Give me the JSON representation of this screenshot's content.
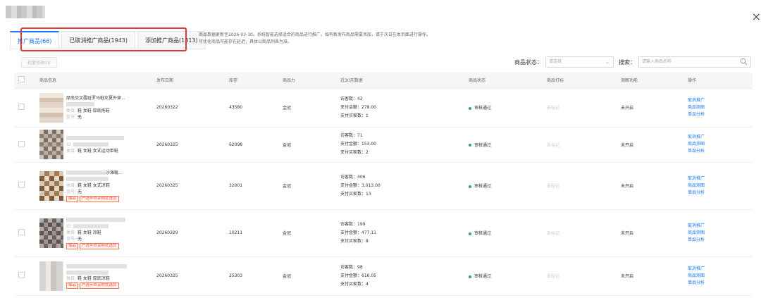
{
  "tabs": [
    {
      "label": "推广商品(66)",
      "active": true
    },
    {
      "label": "已取消推广商品(1943)",
      "active": false
    },
    {
      "label": "添加推广商品(1813)",
      "active": false
    }
  ],
  "close_icon": "×",
  "notice": "商品数据更新至2026-03-30。系统智能选择适合的商品进行推广。如有新发布商品需要添加，请于次日在本页面进行操作。可优化商品可能存在延迟，具体以商品列表为准。",
  "toolbar": {
    "batch_button": "批量修改(0)",
    "status_label": "商品状态：",
    "status_placeholder": "请选择",
    "search_label": "搜索：",
    "search_placeholder": "请输入商品名称"
  },
  "table": {
    "headers": [
      "商品信息",
      "发布日期",
      "库存",
      "商品力",
      "近30天数据",
      "商品状态",
      "商品打标",
      "测图功能",
      "操作"
    ],
    "rows": [
      {
        "title": "厚底交叉露趾罗马鞋女夏外穿...",
        "category": "鞋 女鞋 厚底拖鞋",
        "sku": "无",
        "date": "20260322",
        "stock": "43580",
        "power": "金冠",
        "visitors": "访客数：42",
        "amount": "支付金额：278.00",
        "buyers": "支付买家数：1",
        "status": "审核通过",
        "mark": "去标记",
        "test": "未开启",
        "ops": [
          "取消推广",
          "商品测图",
          "单品分析"
        ]
      },
      {
        "title": "",
        "category": "鞋 女鞋 女式运动单鞋",
        "sku": "",
        "date": "20260325",
        "stock": "62098",
        "power": "金冠",
        "visitors": "访客数：71",
        "amount": "支付金额：153.00",
        "buyers": "支付买家数：2",
        "status": "审核通过",
        "mark": "去标记",
        "test": "未开启",
        "ops": [
          "取消推广",
          "商品测图",
          "单品分析"
        ]
      },
      {
        "title": "沙滩靴...",
        "category": "鞋 女鞋 女式凉鞋",
        "sku": "无",
        "tags": [
          "爆品",
          "严选年终采购优选货"
        ],
        "date": "20260325",
        "stock": "32001",
        "power": "金冠",
        "visitors": "访客数：306",
        "amount": "支付金额：3,013.00",
        "buyers": "支付买家数：13",
        "status": "审核通过",
        "mark": "去标记",
        "test": "未开启",
        "ops": [
          "取消推广",
          "商品测图",
          "单品分析"
        ]
      },
      {
        "title": "",
        "category": "鞋 女鞋 凉鞋",
        "sku": "无",
        "tags": [
          "爆品",
          "严选年终采购优选货"
        ],
        "date": "20260329",
        "stock": "10211",
        "power": "金冠",
        "visitors": "访客数：199",
        "amount": "支付金额：477.11",
        "buyers": "支付买家数：8",
        "status": "审核通过",
        "mark": "去标记",
        "test": "未开启",
        "ops": [
          "取消推广",
          "商品测图",
          "单品分析"
        ]
      },
      {
        "title": "",
        "category": "鞋 女鞋 厚底凉鞋",
        "sku": "",
        "tags": [
          "爆品",
          "严选年终采购优选货"
        ],
        "date": "20260325",
        "stock": "25303",
        "power": "金冠",
        "visitors": "访客数：98",
        "amount": "支付金额：616.05",
        "buyers": "支付买家数：4",
        "status": "审核通过",
        "mark": "去标记",
        "test": "未开启",
        "ops": [
          "取消推广",
          "商品测图",
          "单品分析"
        ]
      }
    ]
  },
  "labels": {
    "category_prefix": "类目:",
    "sku_prefix": "货号:",
    "id_prefix": "ID:"
  },
  "colors": {
    "accent": "#1677ff",
    "highlight_box": "#e03b3b",
    "status_ok": "#21b35a",
    "tag": "#ff4d4f"
  }
}
